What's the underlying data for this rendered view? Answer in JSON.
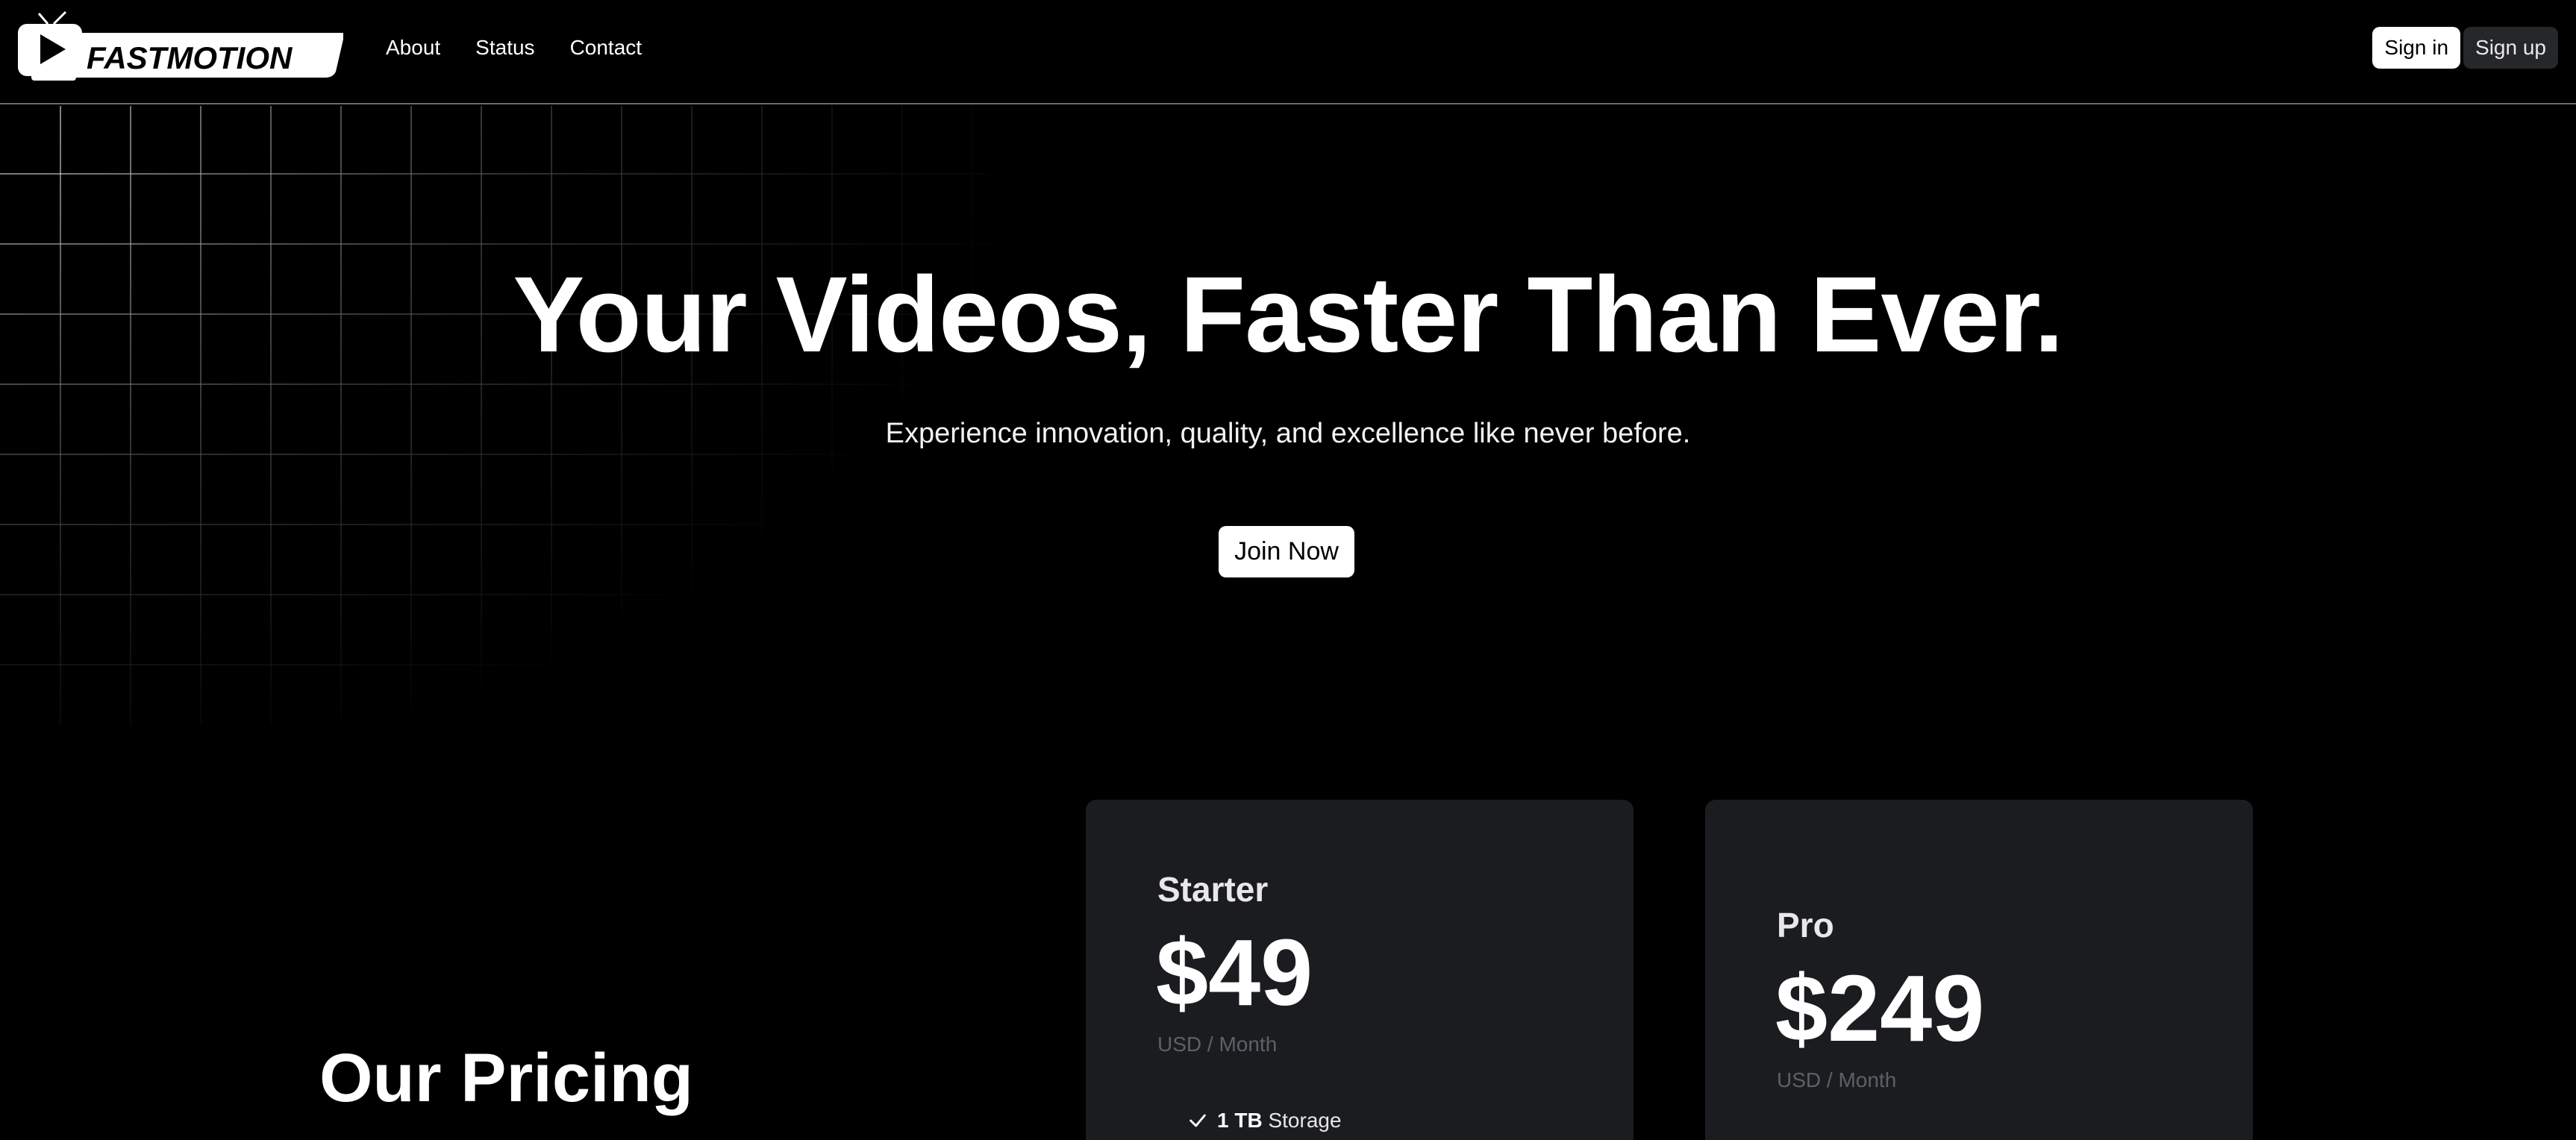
{
  "brand": {
    "name": "FASTMOTION"
  },
  "nav": {
    "links": [
      {
        "label": "About"
      },
      {
        "label": "Status"
      },
      {
        "label": "Contact"
      }
    ],
    "signin_label": "Sign in",
    "signup_label": "Sign up"
  },
  "hero": {
    "title": "Your Videos, Faster Than Ever.",
    "subtitle": "Experience innovation, quality, and excellence like never before.",
    "cta_label": "Join Now"
  },
  "pricing": {
    "heading": "Our Pricing",
    "plans": [
      {
        "name": "Starter",
        "price": "$49",
        "unit": "USD / Month",
        "features": [
          {
            "bold": "1 TB",
            "text": "Storage"
          }
        ]
      },
      {
        "name": "Pro",
        "price": "$249",
        "unit": "USD / Month",
        "features": []
      }
    ]
  },
  "icons": {
    "logo": "tv-play-icon",
    "feature_check": "check-icon"
  },
  "colors": {
    "background": "#000000",
    "card": "#1b1c1f",
    "primary_button": "#ffffff",
    "secondary_button": "#26272b",
    "muted_text": "#5f6066"
  }
}
